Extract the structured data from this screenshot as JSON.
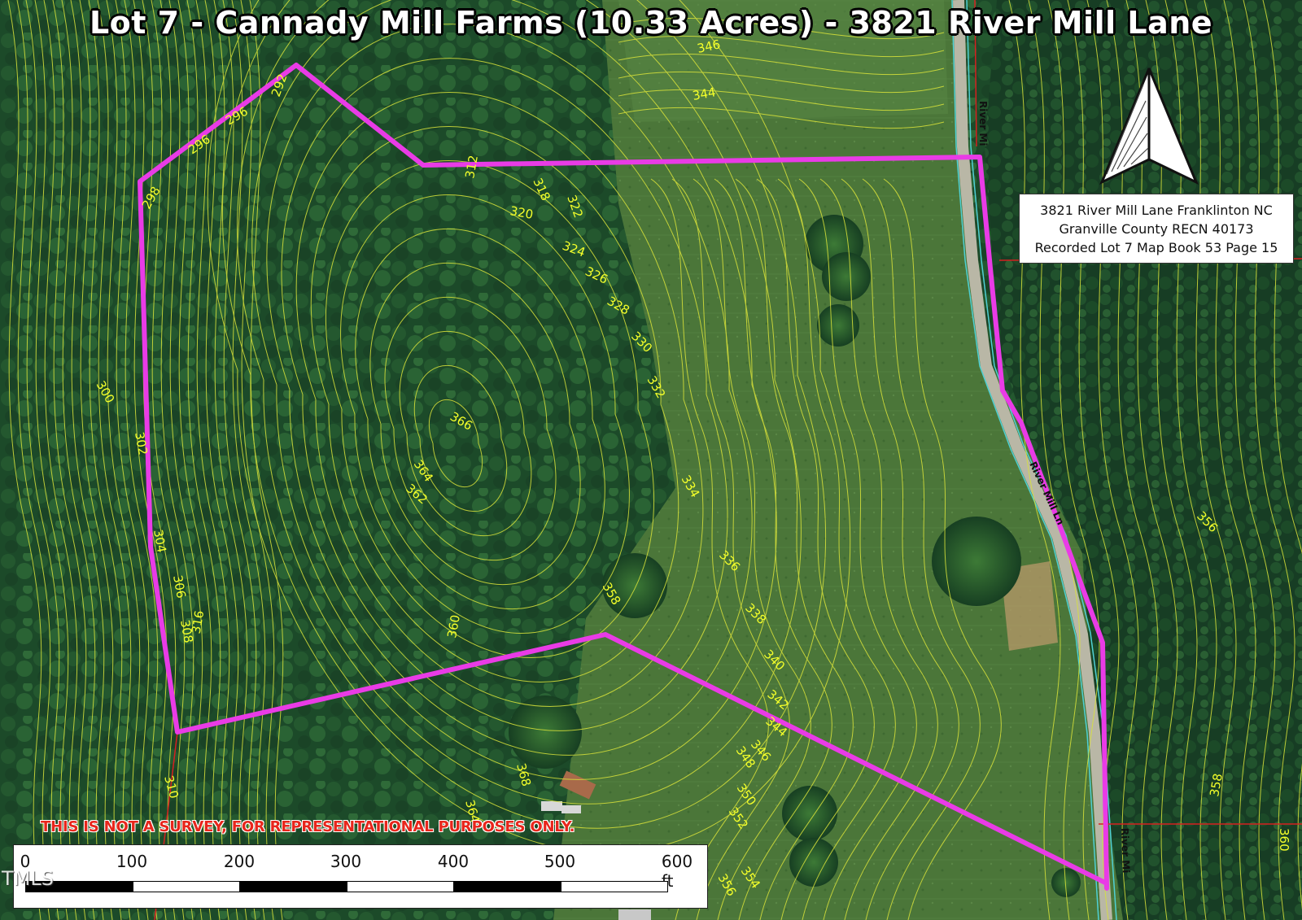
{
  "map": {
    "title": "Lot 7 - Cannady Mill Farms (10.33 Acres) - 3821 River Mill Lane",
    "info": {
      "line1": "3821 River Mill Lane Franklinton NC",
      "line2": "Granville County RECN 40173",
      "line3": "Recorded Lot 7 Map Book 53 Page 15"
    },
    "disclaimer": "THIS IS NOT A SURVEY, FOR REPRESENTATIONAL PURPOSES ONLY.",
    "scale": {
      "labels": [
        "0",
        "100",
        "200",
        "300",
        "400",
        "500",
        "600 ft"
      ]
    },
    "watermark": "TMLS",
    "road_name": "River Mill Ln",
    "road_labels": [
      "River Mi",
      "River Mill Ln",
      "River Mi"
    ],
    "colors": {
      "boundary": "#e93be6",
      "contour": "#d8e23a",
      "contour_label": "#f4ff2a",
      "road_edge": "#4fd0d4",
      "parcel_line": "#d62020",
      "forest": "#1f4d2b",
      "field": "#4f7a3e"
    },
    "contour_labels": [
      "346",
      "344",
      "292",
      "296",
      "296",
      "298",
      "312",
      "318",
      "320",
      "322",
      "324",
      "326",
      "328",
      "330",
      "332",
      "366",
      "364",
      "362",
      "334",
      "336",
      "338",
      "340",
      "342",
      "344",
      "346",
      "348",
      "350",
      "352",
      "354",
      "356",
      "358",
      "360",
      "300",
      "302",
      "304",
      "306",
      "308",
      "316",
      "310",
      "368",
      "364",
      "356",
      "358",
      "360"
    ],
    "icons": [
      "north-arrow-icon"
    ]
  }
}
